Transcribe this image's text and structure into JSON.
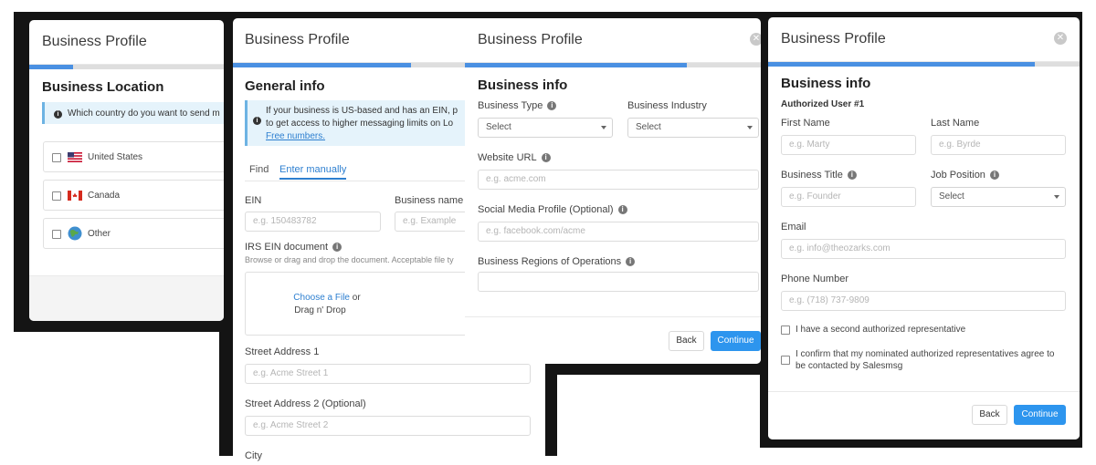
{
  "modal1": {
    "title": "Business Profile",
    "heading": "Business Location",
    "info": "Which country do you want to send m",
    "options": [
      "United States",
      "Canada",
      "Other"
    ],
    "progress": 0.2
  },
  "modal2": {
    "title": "Business Profile",
    "heading": "General info",
    "info_line1": "If your business is US-based and has an EIN, p",
    "info_line2": "to get access to higher messaging limits on Lo",
    "info_line3": "Free numbers.",
    "tab_find": "Find",
    "tab_manual": "Enter manually",
    "ein_label": "EIN",
    "ein_placeholder": "e.g. 150483782",
    "bizname_label": "Business name",
    "bizname_placeholder": "e.g. Example",
    "irs_label": "IRS EIN document",
    "irs_help": "Browse or drag and drop the document. Acceptable file ty",
    "choose_file": "Choose a File",
    "or": "or",
    "drag_drop": "Drag n' Drop",
    "street1_label": "Street Address 1",
    "street1_placeholder": "e.g. Acme Street 1",
    "street2_label": "Street Address 2 (Optional)",
    "street2_placeholder": "e.g. Acme Street 2",
    "city_label": "City",
    "progress": 0.55
  },
  "modal3": {
    "title": "Business Profile",
    "heading": "Business info",
    "type_label": "Business Type",
    "type_value": "Select",
    "industry_label": "Business Industry",
    "industry_value": "Select",
    "website_label": "Website URL",
    "website_placeholder": "e.g. acme.com",
    "social_label": "Social Media Profile (Optional)",
    "social_placeholder": "e.g. facebook.com/acme",
    "regions_label": "Business Regions of Operations",
    "back": "Back",
    "continue": "Continue",
    "progress": 0.75
  },
  "modal4": {
    "title": "Business Profile",
    "heading": "Business info",
    "subheading": "Authorized User #1",
    "first_label": "First Name",
    "first_placeholder": "e.g. Marty",
    "last_label": "Last Name",
    "last_placeholder": "e.g. Byrde",
    "btitle_label": "Business Title",
    "btitle_placeholder": "e.g. Founder",
    "job_label": "Job Position",
    "job_value": "Select",
    "email_label": "Email",
    "email_placeholder": "e.g. info@theozarks.com",
    "phone_label": "Phone Number",
    "phone_placeholder": "e.g. (718) 737-9809",
    "check1": "I have a second authorized representative",
    "check2_line1": "I confirm that my nominated authorized representatives agree to",
    "check2_line2": "be contacted by Salesmsg",
    "back": "Back",
    "continue": "Continue",
    "progress": 0.98
  }
}
